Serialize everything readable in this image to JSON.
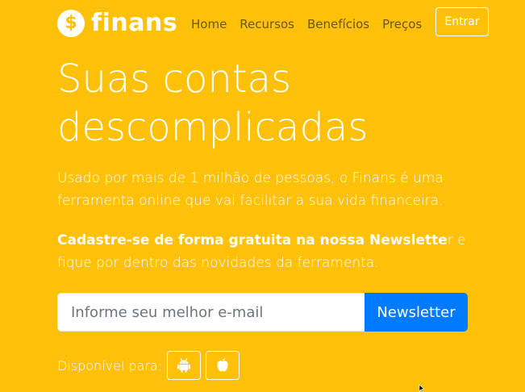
{
  "brand": {
    "symbol": "$",
    "name": "finans"
  },
  "nav": {
    "links": [
      "Home",
      "Recursos",
      "Benefícios",
      "Preços"
    ],
    "login_label": "Entrar"
  },
  "hero": {
    "title_line1": "Suas contas",
    "title_line2": "descomplicadas",
    "lead": "Usado por mais de 1 milhão de pessoas, o Finans é uma ferramenta online que vai facilitar a sua vida financeira.",
    "cta_bold": "Cadastre-se de forma gratuita na nossa Newslette",
    "cta_rest": "r e fique por dentro das novidades da ferramenta."
  },
  "newsletter": {
    "placeholder": "Informe seu melhor e-mail",
    "button_label": "Newsletter"
  },
  "available": {
    "label": "Disponível para:",
    "platforms": [
      "android-icon",
      "apple-icon"
    ]
  },
  "colors": {
    "background": "#ffc107",
    "primary": "#007bff",
    "nav_text": "#6b5510",
    "text": "#ffffff"
  }
}
